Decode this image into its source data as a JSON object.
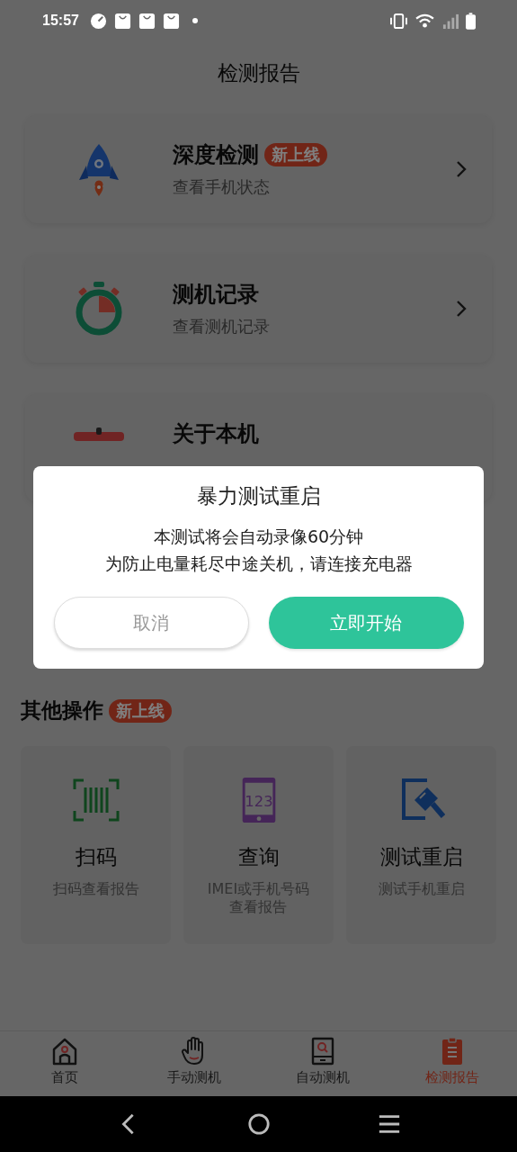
{
  "status_bar": {
    "time": "15:57"
  },
  "header": {
    "title": "检测报告"
  },
  "cards": [
    {
      "title": "深度检测",
      "badge": "新上线",
      "subtitle": "查看手机状态",
      "chevron": true
    },
    {
      "title": "测机记录",
      "subtitle": "查看测机记录",
      "chevron": true
    },
    {
      "title": "关于本机",
      "chevron": false
    }
  ],
  "other_section": {
    "title": "其他操作",
    "badge": "新上线"
  },
  "tiles": [
    {
      "title": "扫码",
      "subtitle": "扫码查看报告"
    },
    {
      "title": "查询",
      "subtitle_lines": [
        "IMEI或手机号码",
        "查看报告"
      ],
      "icon_text": "123"
    },
    {
      "title": "测试重启",
      "subtitle": "测试手机重启"
    }
  ],
  "tab_bar": [
    {
      "label": "首页",
      "selected": false
    },
    {
      "label": "手动测机",
      "selected": false
    },
    {
      "label": "自动测机",
      "selected": false
    },
    {
      "label": "检测报告",
      "selected": true
    }
  ],
  "dialog": {
    "title": "暴力测试重启",
    "message_lines": [
      "本测试将会自动录像60分钟",
      "为防止电量耗尽中途关机，请连接充电器"
    ],
    "buttons": [
      {
        "label": "取消",
        "kind": "cancel"
      },
      {
        "label": "立即开始",
        "kind": "confirm"
      }
    ]
  }
}
